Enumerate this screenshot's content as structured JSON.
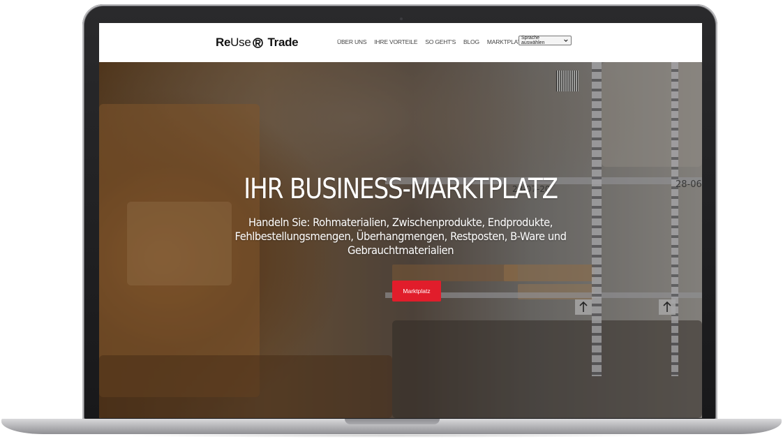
{
  "logo": {
    "part_re": "Re",
    "part_use": "Use",
    "part_trade": "Trade"
  },
  "nav": {
    "items": [
      {
        "label": "ÜBER UNS"
      },
      {
        "label": "IHRE VORTEILE"
      },
      {
        "label": "SO GEHT'S"
      },
      {
        "label": "BLOG"
      },
      {
        "label": "MARKTPLATZ"
      }
    ],
    "language_select": {
      "selected": "Sprache auswählen"
    }
  },
  "hero": {
    "title": "IHR BUSINESS-MARKTPLATZ",
    "subtitle": "Handeln Sie: Rohmaterialien, Zwischenprodukte, Endprodukte, Fehlbestellungsmengen, Überhangmengen, Restposten, B-Ware und Gebrauchtmaterialien",
    "button_label": "Marktplatz",
    "shelf_labels": [
      "28-07-20",
      "28-06"
    ]
  },
  "colors": {
    "accent": "#e11d2b",
    "header_bg": "#ffffff",
    "text_on_hero": "#ffffff"
  },
  "icons": {
    "logo_mark": "recycle-r-icon",
    "select_caret": "chevron-down-icon",
    "shelf_arrow": "arrow-up-icon"
  }
}
